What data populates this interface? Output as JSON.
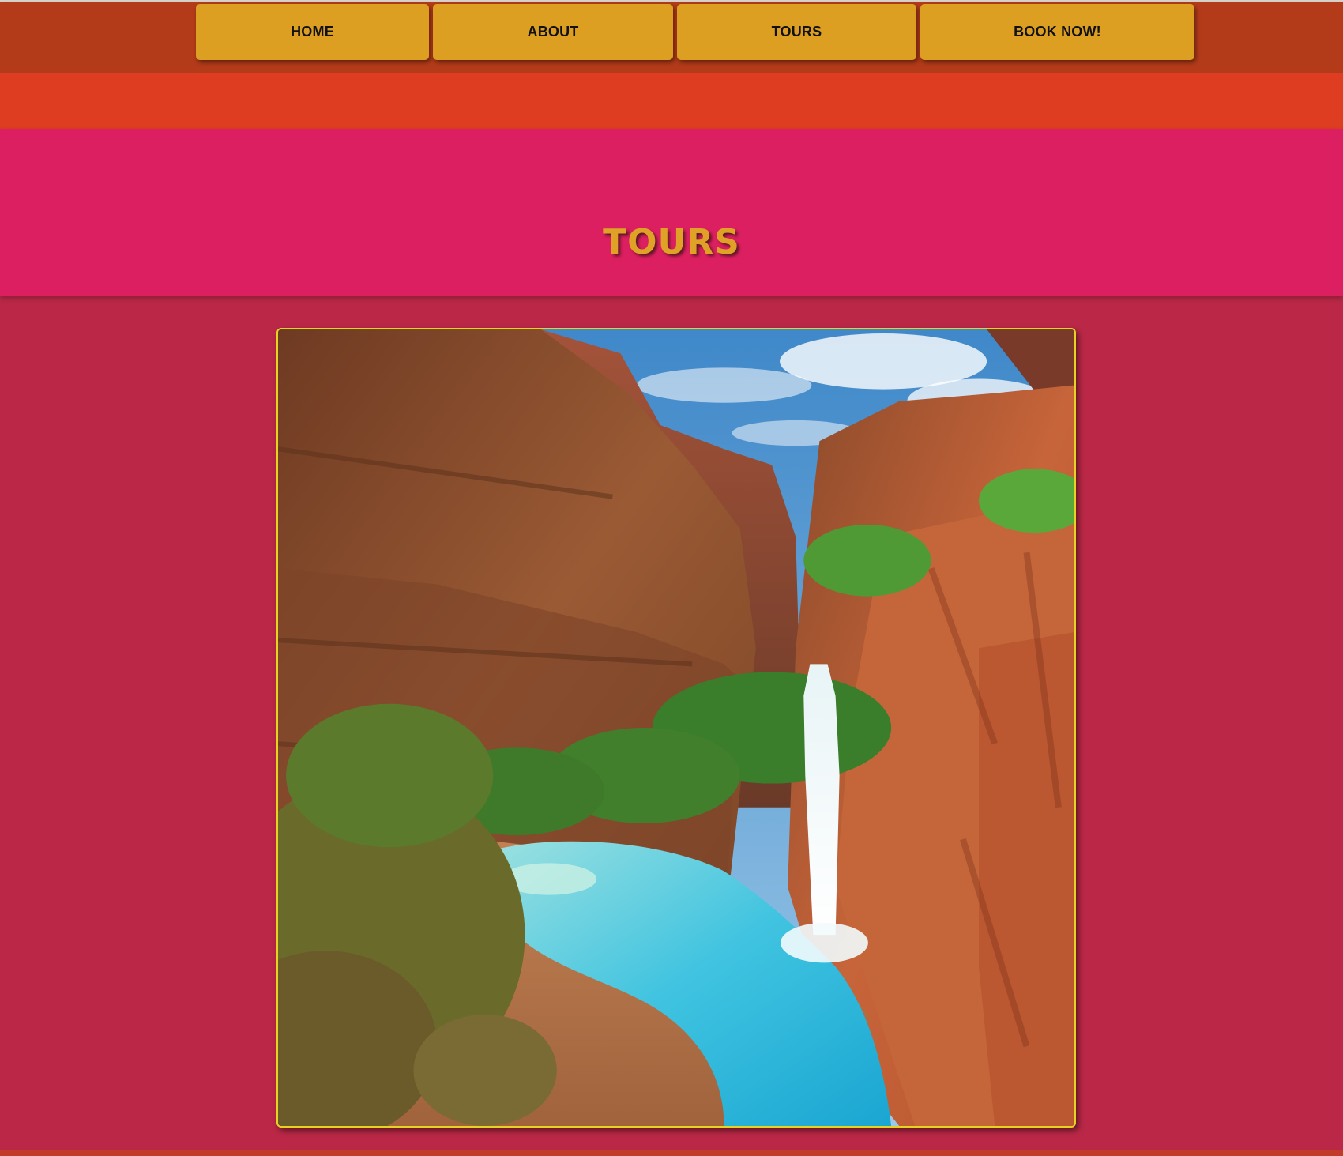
{
  "nav": {
    "home": "HOME",
    "about": "ABOUT",
    "tours": "TOURS",
    "book": "BOOK NOW!"
  },
  "page": {
    "title": "TOURS"
  },
  "hero": {
    "image": "canyon-waterfall-photo"
  },
  "colors": {
    "navbar": "#b43b19",
    "nav_button": "#dd9f21",
    "orange_band": "#de3d22",
    "pink_band": "#dc1f60",
    "background": "#bb2847",
    "title": "#e0a127",
    "frame_border": "#e6d321"
  }
}
